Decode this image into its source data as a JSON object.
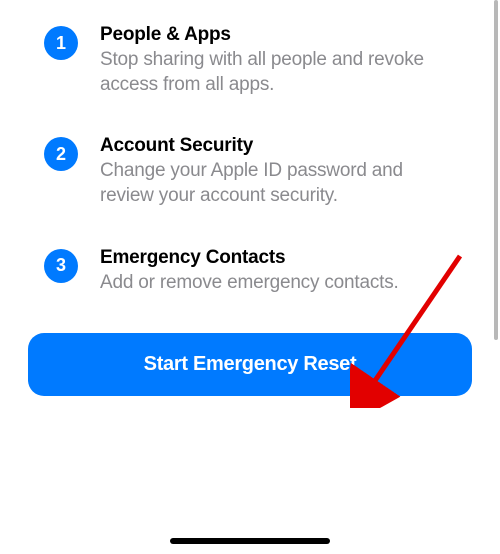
{
  "steps": [
    {
      "number": "1",
      "title": "People & Apps",
      "desc": "Stop sharing with all people and revoke access from all apps."
    },
    {
      "number": "2",
      "title": "Account Security",
      "desc": "Change your Apple ID password and review your account security."
    },
    {
      "number": "3",
      "title": "Emergency Contacts",
      "desc": "Add or remove emergency contacts."
    }
  ],
  "button": {
    "label": "Start Emergency Reset"
  },
  "colors": {
    "accent": "#007aff",
    "textSecondary": "#8a8a8e"
  }
}
